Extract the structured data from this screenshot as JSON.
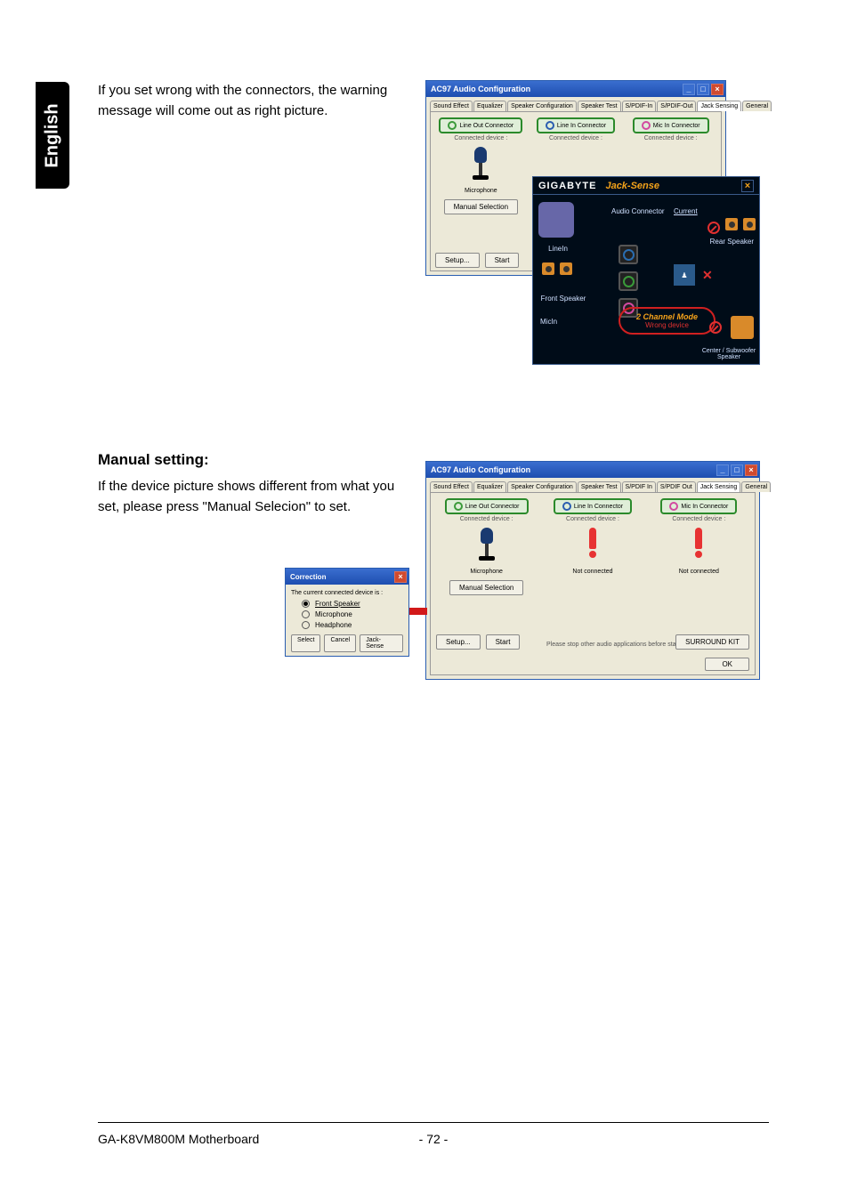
{
  "side_tab": "English",
  "para1": "If you set wrong with the connectors, the warning message will come out as right picture.",
  "heading": "Manual setting:",
  "para2": "If the device picture shows different from what you set, please press \"Manual Selecion\" to set.",
  "footer": {
    "left": "GA-K8VM800M Motherboard",
    "page": "- 72 -"
  },
  "shot1": {
    "title": "AC97 Audio Configuration",
    "tabs": [
      "Sound Effect",
      "Equalizer",
      "Speaker Configuration",
      "Speaker Test",
      "S/PDIF-In",
      "S/PDIF-Out",
      "Jack Sensing",
      "General"
    ],
    "active_tab": 6,
    "connectors": {
      "line_out": {
        "label": "Line Out Connector",
        "sub": "Connected device :",
        "status": "Microphone"
      },
      "line_in": {
        "label": "Line In Connector",
        "sub": "Connected device :"
      },
      "mic_in": {
        "label": "Mic In Connector",
        "sub": "Connected device :"
      }
    },
    "manual_selection": "Manual Selection",
    "buttons": {
      "setup": "Setup...",
      "start": "Start"
    },
    "jacksense": {
      "brand": "GIGABYTE",
      "title": "Jack-Sense",
      "audio_connector": "Audio Connector",
      "current": "Current",
      "linein_label": "LineIn",
      "rear_speaker": "Rear Speaker",
      "front_speaker": "Front Speaker",
      "micin_label": "MicIn",
      "center_sub": "Center / Subwoofer Speaker",
      "badge_line1": "2 Channel Mode",
      "badge_line2": "Wrong device"
    }
  },
  "shot2": {
    "title": "AC97 Audio Configuration",
    "tabs": [
      "Sound Effect",
      "Equalizer",
      "Speaker Configuration",
      "Speaker Test",
      "S/PDIF In",
      "S/PDIF Out",
      "Jack Sensing",
      "General"
    ],
    "active_tab": 6,
    "connectors": {
      "line_out": {
        "label": "Line Out Connector",
        "sub": "Connected device :",
        "status": "Microphone"
      },
      "line_in": {
        "label": "Line In Connector",
        "sub": "Connected device :",
        "status": "Not connected"
      },
      "mic_in": {
        "label": "Mic In Connector",
        "sub": "Connected device :",
        "status": "Not connected"
      }
    },
    "manual_selection": "Manual Selection",
    "buttons": {
      "setup": "Setup...",
      "start": "Start",
      "ok": "OK"
    },
    "notice": "Please stop other audio applications before starting.",
    "surround": "SURROUND KIT"
  },
  "correction": {
    "title": "Correction",
    "prompt": "The current connected device is :",
    "options": [
      "Front Speaker",
      "Microphone",
      "Headphone"
    ],
    "selected": 0,
    "buttons": {
      "select": "Select",
      "cancel": "Cancel",
      "jacksense": "Jack-Sense"
    }
  }
}
